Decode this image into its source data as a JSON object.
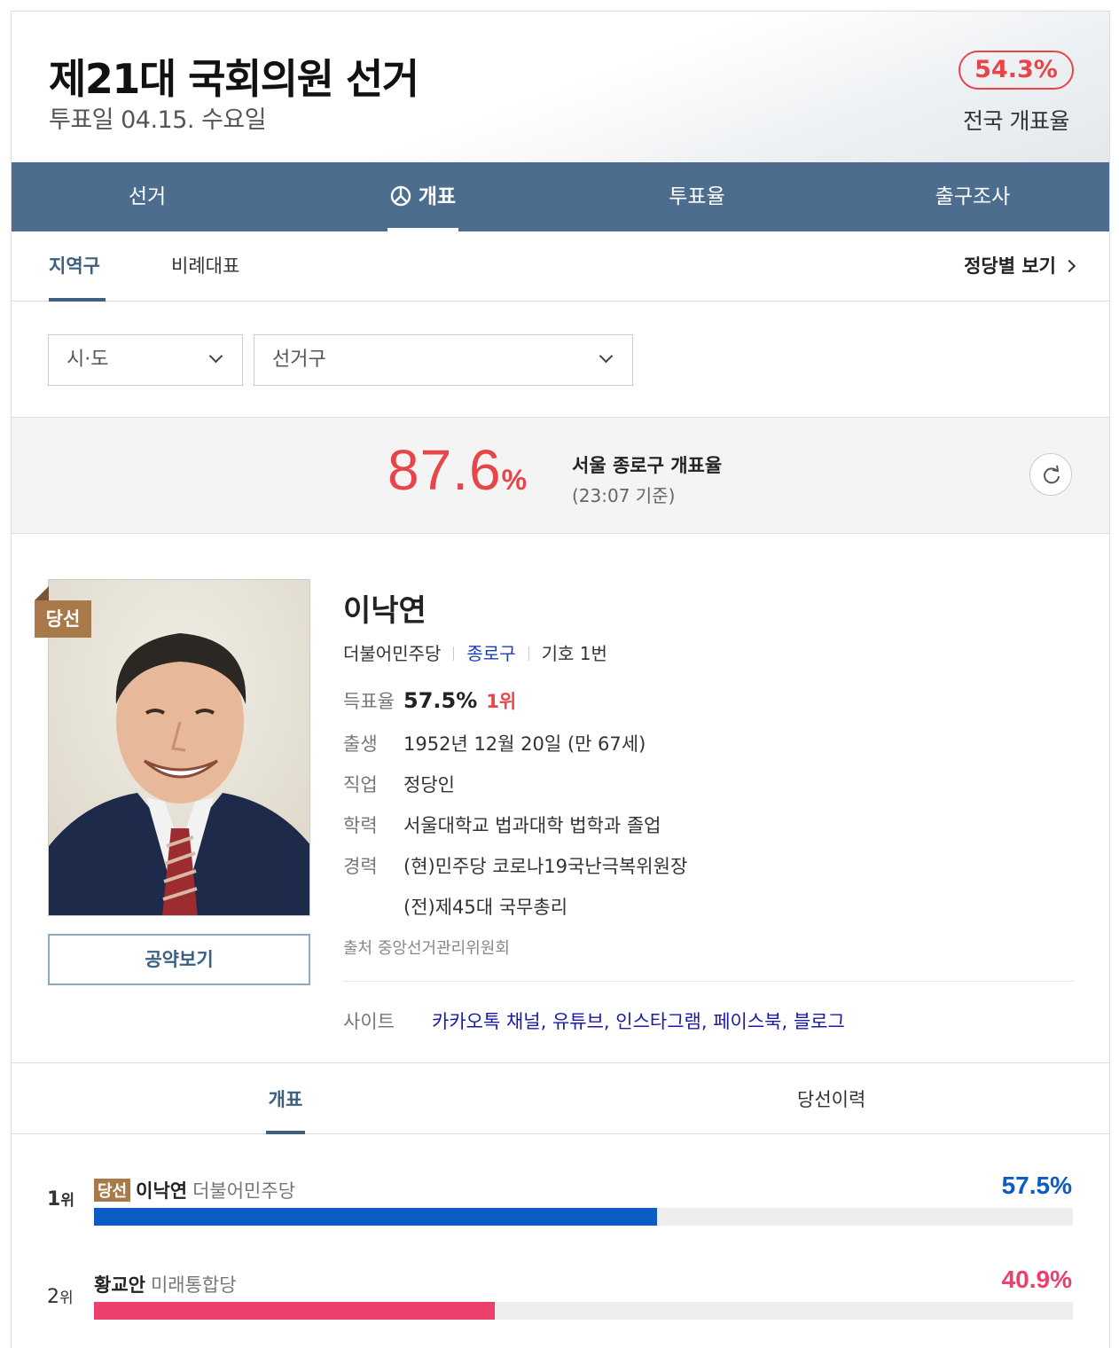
{
  "header": {
    "title": "제21대 국회의원 선거",
    "date": "투표일 04.15. 수요일",
    "national_rate": "54.3%",
    "national_rate_label": "전국 개표율"
  },
  "main_nav": {
    "tabs": [
      {
        "label": "선거",
        "active": false
      },
      {
        "label": "개표",
        "active": true,
        "icon": "ballot-icon"
      },
      {
        "label": "투표율",
        "active": false
      },
      {
        "label": "출구조사",
        "active": false
      }
    ]
  },
  "sub_nav": {
    "tabs": [
      {
        "label": "지역구",
        "active": true
      },
      {
        "label": "비례대표",
        "active": false
      }
    ],
    "party_link": "정당별 보기"
  },
  "filters": {
    "region_select": "시·도",
    "district_select": "선거구"
  },
  "count_rate": {
    "value": "87.6",
    "unit": "%",
    "label": "서울 종로구 개표율",
    "time": "(23:07 기준)"
  },
  "candidate": {
    "badge": "당선",
    "name": "이낙연",
    "party": "더불어민주당",
    "district": "종로구",
    "number": "기호 1번",
    "vote_share_label": "득표율",
    "vote_share": "57.5%",
    "rank": "1위",
    "birth_label": "출생",
    "birth": "1952년 12월 20일 (만 67세)",
    "job_label": "직업",
    "job": "정당인",
    "education_label": "학력",
    "education": "서울대학교 법과대학 법학과 졸업",
    "career_label": "경력",
    "career": [
      "(현)민주당 코로나19국난극복위원장",
      "(전)제45대 국무총리"
    ],
    "source": "출처 중앙선거관리위원회",
    "sites_label": "사이트",
    "sites": "카카오톡 채널, 유튜브, 인스타그램, 페이스북, 블로그",
    "pledge_button": "공약보기"
  },
  "result_tabs": [
    {
      "label": "개표",
      "active": true
    },
    {
      "label": "당선이력",
      "active": false
    }
  ],
  "results": [
    {
      "rank": "1",
      "rank_unit": "위",
      "badge": "당선",
      "name": "이낙연",
      "party": "더불어민주당",
      "pct": "57.5%",
      "share": 0.575,
      "color": "#0b5cc4"
    },
    {
      "rank": "2",
      "rank_unit": "위",
      "badge": "",
      "name": "황교안",
      "party": "미래통합당",
      "pct": "40.9%",
      "share": 0.409,
      "color": "#ec3f6b"
    }
  ],
  "colors": {
    "accent_red": "#e8454a",
    "nav_blue": "#4d6d8f",
    "winner_badge": "#a87a4b"
  }
}
